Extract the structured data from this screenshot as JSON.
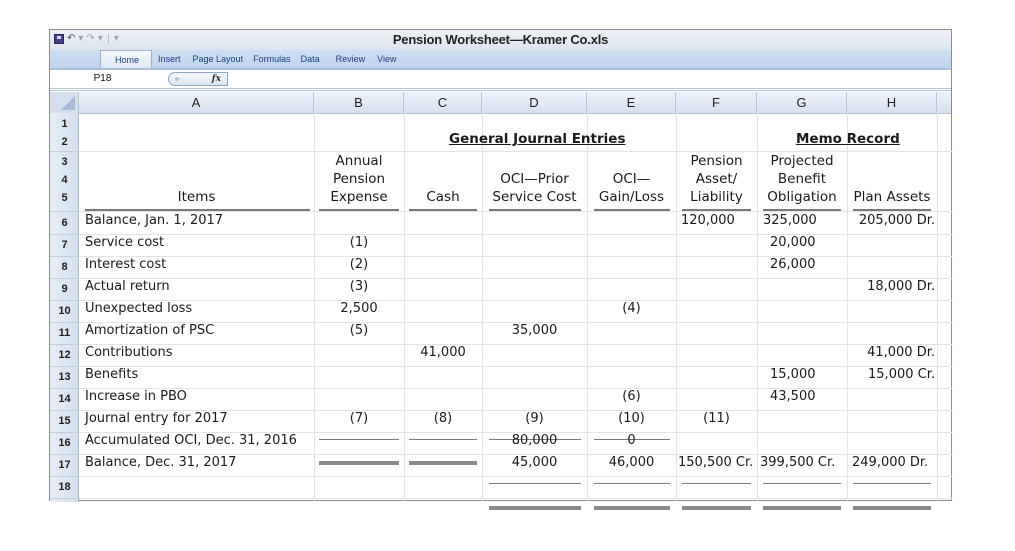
{
  "window": {
    "title": "Pension Worksheet—Kramer Co.xls",
    "quick_access": [
      "save-icon",
      "undo-icon",
      "redo-icon",
      "customize-icon"
    ]
  },
  "ribbon": {
    "tabs": [
      "Home",
      "Insert",
      "Page Layout",
      "Formulas",
      "Data",
      "Review",
      "View"
    ],
    "active_tab": "Home"
  },
  "formula_bar": {
    "name_box": "P18",
    "fx_label": "fx",
    "value": ""
  },
  "columns": [
    "A",
    "B",
    "C",
    "D",
    "E",
    "F",
    "G",
    "H"
  ],
  "row_numbers": [
    "1",
    "2",
    "3",
    "4",
    "5",
    "6",
    "7",
    "8",
    "9",
    "10",
    "11",
    "12",
    "13",
    "14",
    "15",
    "16",
    "17",
    "18"
  ],
  "sheet": {
    "section_journal": "General Journal Entries",
    "section_memo": "Memo Record",
    "headers": {
      "A": [
        "Items"
      ],
      "B": [
        "Annual",
        "Pension",
        "Expense"
      ],
      "C": [
        "Cash"
      ],
      "D": [
        "OCI—Prior",
        "Service Cost"
      ],
      "E": [
        "OCI—",
        "Gain/Loss"
      ],
      "F": [
        "Pension",
        "Asset/",
        "Liability"
      ],
      "G": [
        "Projected",
        "Benefit",
        "Obligation"
      ],
      "H": [
        "Plan Assets"
      ]
    },
    "rows": [
      {
        "row": 6,
        "A": "Balance, Jan. 1, 2017",
        "B": "",
        "C": "",
        "D": "",
        "E": "",
        "F": "120,000",
        "G": "325,000",
        "H": "205,000 Dr."
      },
      {
        "row": 7,
        "A": "Service cost",
        "B": "(1)",
        "C": "",
        "D": "",
        "E": "",
        "F": "",
        "G": "20,000",
        "H": ""
      },
      {
        "row": 8,
        "A": "Interest cost",
        "B": "(2)",
        "C": "",
        "D": "",
        "E": "",
        "F": "",
        "G": "26,000",
        "H": ""
      },
      {
        "row": 9,
        "A": "Actual return",
        "B": "(3)",
        "C": "",
        "D": "",
        "E": "",
        "F": "",
        "G": "",
        "H": "18,000 Dr."
      },
      {
        "row": 10,
        "A": "Unexpected loss",
        "B": "2,500",
        "C": "",
        "D": "",
        "E": "(4)",
        "F": "",
        "G": "",
        "H": ""
      },
      {
        "row": 11,
        "A": "Amortization of PSC",
        "B": "(5)",
        "C": "",
        "D": "35,000",
        "E": "",
        "F": "",
        "G": "",
        "H": ""
      },
      {
        "row": 12,
        "A": "Contributions",
        "B": "",
        "C": "41,000",
        "D": "",
        "E": "",
        "F": "",
        "G": "",
        "H": "41,000 Dr."
      },
      {
        "row": 13,
        "A": "Benefits",
        "B": "",
        "C": "",
        "D": "",
        "E": "",
        "F": "",
        "G": "15,000",
        "H": "15,000 Cr."
      },
      {
        "row": 14,
        "A": "Increase in PBO",
        "B": "",
        "C": "",
        "D": "",
        "E": "(6)",
        "F": "",
        "G": "43,500",
        "H": ""
      },
      {
        "row": 15,
        "A": "Journal entry for 2017",
        "B": "(7)",
        "C": "(8)",
        "D": "(9)",
        "E": "(10)",
        "F": "(11)",
        "G": "",
        "H": ""
      },
      {
        "row": 16,
        "A": "Accumulated OCI, Dec. 31, 2016",
        "B": "",
        "C": "",
        "D": "80,000",
        "E": "0",
        "F": "",
        "G": "",
        "H": ""
      },
      {
        "row": 17,
        "A": "Balance, Dec. 31, 2017",
        "B": "",
        "C": "",
        "D": "45,000",
        "E": "46,000",
        "F": "150,500 Cr.",
        "G": "399,500 Cr.",
        "H": "249,000 Dr."
      },
      {
        "row": 18,
        "A": "",
        "B": "",
        "C": "",
        "D": "",
        "E": "",
        "F": "",
        "G": "",
        "H": ""
      }
    ]
  }
}
